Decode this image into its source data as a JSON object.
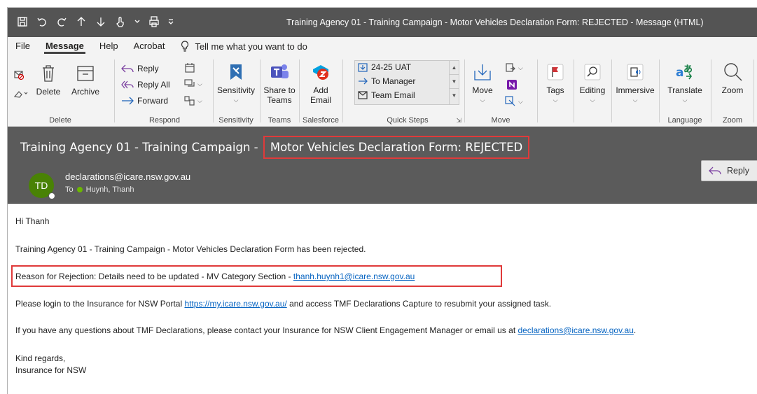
{
  "window": {
    "title": "Training Agency 01 - Training Campaign - Motor Vehicles Declaration Form: REJECTED  -  Message (HTML)"
  },
  "menu": {
    "items": [
      "File",
      "Message",
      "Help",
      "Acrobat"
    ],
    "active": "Message",
    "tell_me": "Tell me what you want to do"
  },
  "ribbon": {
    "delete": {
      "delete_label": "Delete",
      "archive_label": "Archive",
      "group_label": "Delete"
    },
    "respond": {
      "reply": "Reply",
      "reply_all": "Reply All",
      "forward": "Forward",
      "group_label": "Respond"
    },
    "sensitivity": {
      "label": "Sensitivity",
      "group_label": "Sensitivity"
    },
    "teams": {
      "label_line1": "Share to",
      "label_line2": "Teams",
      "group_label": "Teams"
    },
    "salesforce": {
      "label_line1": "Add",
      "label_line2": "Email",
      "group_label": "Salesforce"
    },
    "quick_steps": {
      "items": [
        "24-25 UAT",
        "To Manager",
        "Team Email"
      ],
      "group_label": "Quick Steps"
    },
    "move": {
      "label": "Move",
      "group_label": "Move"
    },
    "tags": {
      "label": "Tags"
    },
    "editing": {
      "label": "Editing"
    },
    "immersive": {
      "label": "Immersive"
    },
    "language": {
      "label": "Translate",
      "group_label": "Language"
    },
    "zoom": {
      "label": "Zoom",
      "group_label": "Zoom"
    }
  },
  "message": {
    "subject_prefix": "Training Agency 01 - Training Campaign - ",
    "subject_highlight": "Motor Vehicles Declaration Form: REJECTED",
    "avatar_initials": "TD",
    "sender": "declarations@icare.nsw.gov.au",
    "to_label": "To",
    "to_name": "Huynh, Thanh",
    "reply_label": "Reply"
  },
  "body": {
    "greeting": "Hi Thanh",
    "line1": "Training Agency 01 - Training Campaign - Motor Vehicles Declaration Form has been rejected.",
    "reason_text": "Reason for Rejection: Details need to be updated - MV Category Section - ",
    "reason_email": "thanh.huynh1@icare.nsw.gov.au",
    "login_text": "Please login to the Insurance for NSW Portal ",
    "login_link": "https://my.icare.nsw.gov.au/",
    "login_after": " and access TMF Declarations Capture to resubmit your assigned task.",
    "questions_text": "If you have any questions about TMF Declarations, please contact your Insurance for NSW Client Engagement Manager or email us at ",
    "questions_email": "declarations@icare.nsw.gov.au",
    "questions_after": ".",
    "regards": "Kind regards,",
    "signature": "Insurance for NSW"
  },
  "colors": {
    "titlebar": "#545454",
    "header": "#5b5b5b",
    "highlight_border": "#e03a3a",
    "avatar": "#498205",
    "link": "#0563c1"
  }
}
